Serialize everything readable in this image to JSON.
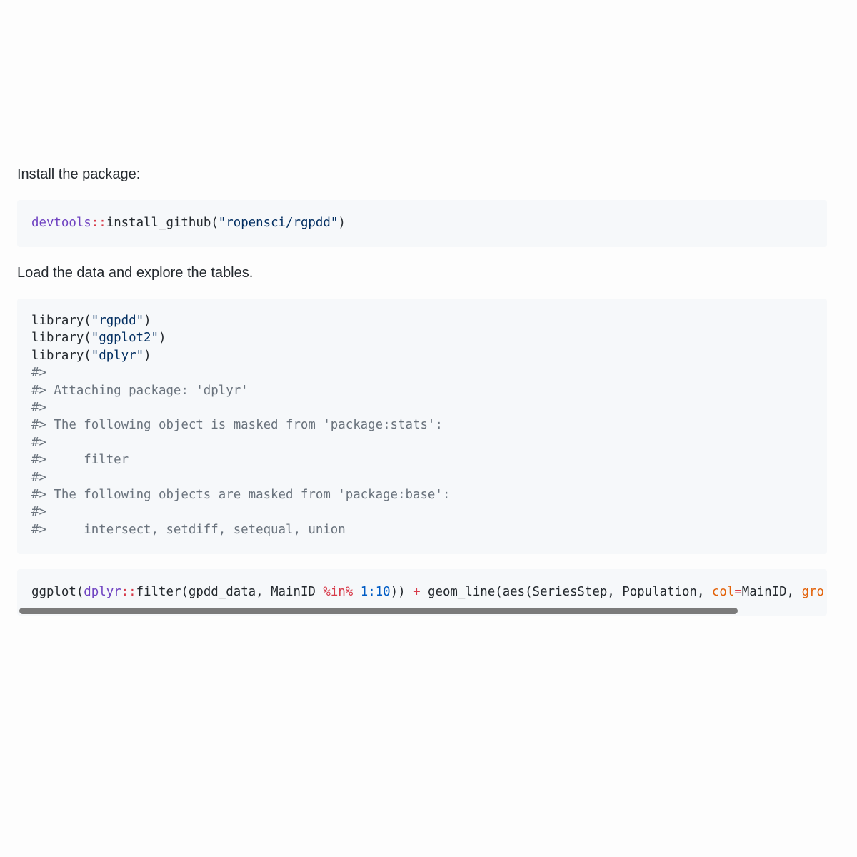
{
  "colors": {
    "code_bg": "#f6f8fa",
    "namespace": "#6f42c1",
    "operator": "#d73a49",
    "string": "#032f62",
    "number": "#005cc5",
    "comment": "#6a737d",
    "argument": "#e36209",
    "scrollbar": "#7b7b7b"
  },
  "paragraphs": [
    "Install the package:",
    "Load the data and explore the tables."
  ],
  "blocks": [
    {
      "lines": [
        [
          {
            "t": "devtools",
            "c": "ns"
          },
          {
            "t": "::",
            "c": "op"
          },
          {
            "t": "install_github(",
            "c": "plain"
          },
          {
            "t": "\"ropensci/rgpdd\"",
            "c": "str"
          },
          {
            "t": ")",
            "c": "plain"
          }
        ]
      ]
    },
    {
      "lines": [
        [
          {
            "t": "library(",
            "c": "plain"
          },
          {
            "t": "\"rgpdd\"",
            "c": "str"
          },
          {
            "t": ")",
            "c": "plain"
          }
        ],
        [
          {
            "t": "library(",
            "c": "plain"
          },
          {
            "t": "\"ggplot2\"",
            "c": "str"
          },
          {
            "t": ")",
            "c": "plain"
          }
        ],
        [
          {
            "t": "library(",
            "c": "plain"
          },
          {
            "t": "\"dplyr\"",
            "c": "str"
          },
          {
            "t": ")",
            "c": "plain"
          }
        ],
        [
          {
            "t": "#>",
            "c": "com"
          }
        ],
        [
          {
            "t": "#> Attaching package: 'dplyr'",
            "c": "com"
          }
        ],
        [
          {
            "t": "#>",
            "c": "com"
          }
        ],
        [
          {
            "t": "#> The following object is masked from 'package:stats':",
            "c": "com"
          }
        ],
        [
          {
            "t": "#>",
            "c": "com"
          }
        ],
        [
          {
            "t": "#>     filter",
            "c": "com"
          }
        ],
        [
          {
            "t": "#>",
            "c": "com"
          }
        ],
        [
          {
            "t": "#> The following objects are masked from 'package:base':",
            "c": "com"
          }
        ],
        [
          {
            "t": "#>",
            "c": "com"
          }
        ],
        [
          {
            "t": "#>     intersect, setdiff, setequal, union",
            "c": "com"
          }
        ]
      ]
    },
    {
      "lines": [
        [
          {
            "t": "ggplot(",
            "c": "plain"
          },
          {
            "t": "dplyr",
            "c": "ns"
          },
          {
            "t": "::",
            "c": "op"
          },
          {
            "t": "filter(gpdd_data, MainID ",
            "c": "plain"
          },
          {
            "t": "%in%",
            "c": "op"
          },
          {
            "t": " ",
            "c": "plain"
          },
          {
            "t": "1:10",
            "c": "num"
          },
          {
            "t": ")) ",
            "c": "plain"
          },
          {
            "t": "+",
            "c": "op"
          },
          {
            "t": " geom_line(aes(SeriesStep, Population, ",
            "c": "plain"
          },
          {
            "t": "col",
            "c": "arg"
          },
          {
            "t": "=",
            "c": "op"
          },
          {
            "t": "MainID, ",
            "c": "plain"
          },
          {
            "t": "gro",
            "c": "arg"
          }
        ]
      ]
    }
  ]
}
